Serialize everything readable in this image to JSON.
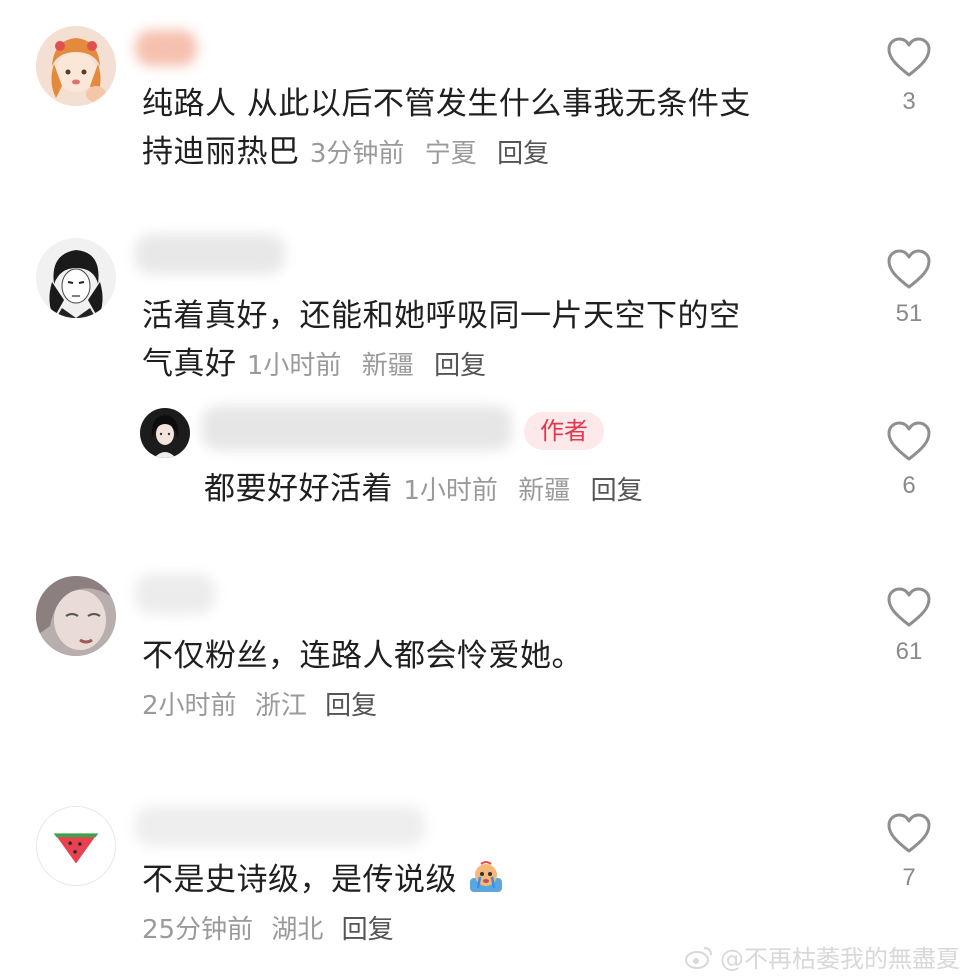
{
  "comments": [
    {
      "text": "纯路人 从此以后不管发生什么事我无条件支持迪丽热巴",
      "text_line1": "纯路人 从此以后不管发生什么事我无条件支",
      "text_line2": "持迪丽热巴",
      "time": "3分钟前",
      "region": "宁夏",
      "reply": "回复",
      "likes": "3"
    },
    {
      "text_line1": "活着真好，还能和她呼吸同一片天空下的空",
      "text_line2": "气真好",
      "time": "1小时前",
      "region": "新疆",
      "reply": "回复",
      "likes": "51",
      "author_reply": {
        "badge": "作者",
        "text": "都要好好活着",
        "time": "1小时前",
        "region": "新疆",
        "reply": "回复",
        "likes": "6"
      }
    },
    {
      "text": "不仅粉丝，连路人都会怜爱她。",
      "time": "2小时前",
      "region": "浙江",
      "reply": "回复",
      "likes": "61"
    },
    {
      "text": "不是史诗级，是传说级",
      "time": "25分钟前",
      "region": "湖北",
      "reply": "回复",
      "likes": "7"
    }
  ],
  "watermark": "@不再枯萎我的無盡夏",
  "colors": {
    "badge_bg": "#fde8ea",
    "badge_text": "#e0384f",
    "meta": "#9a9a9a",
    "heart_stroke": "#8f8f8f"
  }
}
